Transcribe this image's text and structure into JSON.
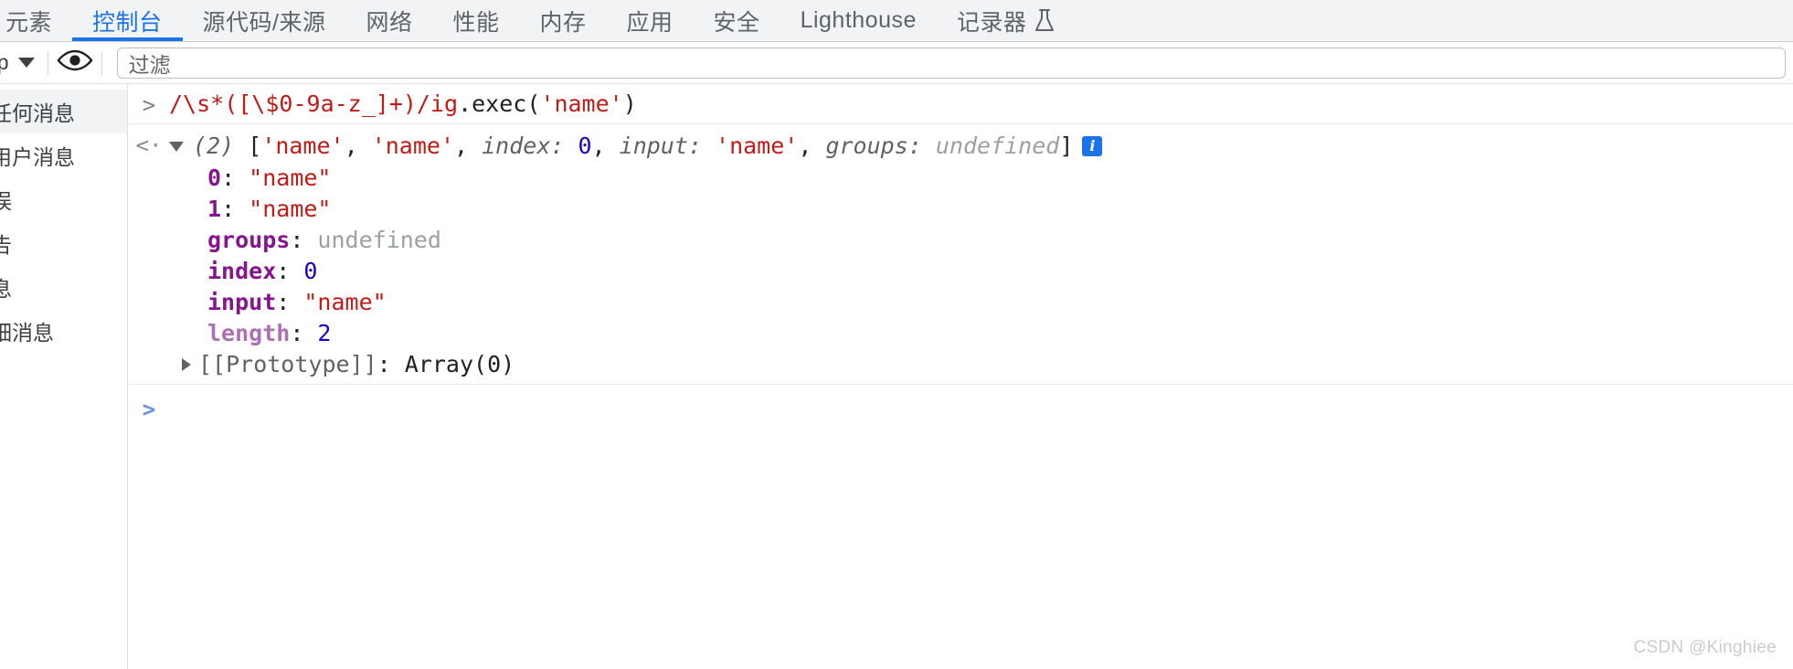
{
  "tabs": [
    {
      "label": "元素",
      "active": false,
      "icon": null
    },
    {
      "label": "控制台",
      "active": true,
      "icon": null
    },
    {
      "label": "源代码/来源",
      "active": false,
      "icon": null
    },
    {
      "label": "网络",
      "active": false,
      "icon": null
    },
    {
      "label": "性能",
      "active": false,
      "icon": null
    },
    {
      "label": "内存",
      "active": false,
      "icon": null
    },
    {
      "label": "应用",
      "active": false,
      "icon": null
    },
    {
      "label": "安全",
      "active": false,
      "icon": null
    },
    {
      "label": "Lighthouse",
      "active": false,
      "icon": null
    },
    {
      "label": "记录器",
      "active": false,
      "icon": "flask-icon"
    }
  ],
  "toolbar": {
    "context_value": "op",
    "context_icon": "chevron-down-icon",
    "eye_icon": "eye-icon",
    "filter_placeholder": "过滤"
  },
  "sidebar": {
    "items": [
      {
        "label": "任何消息",
        "selected": true
      },
      {
        "label": "用户消息",
        "selected": false
      },
      {
        "label": "误",
        "selected": false
      },
      {
        "label": "告",
        "selected": false
      },
      {
        "label": "息",
        "selected": false
      },
      {
        "label": "细消息",
        "selected": false
      }
    ]
  },
  "console": {
    "input_prompt": ">",
    "input_regex": "/\\s*([\\$0-9a-z_]+)/ig",
    "input_call": ".exec(",
    "input_arg": "'name'",
    "input_close": ")",
    "return_prompt": "<·",
    "result": {
      "count": "(2)",
      "open_bracket": "[",
      "item0": "'name'",
      "comma1": ", ",
      "item1": "'name'",
      "comma2": ", ",
      "meta_index_key": "index: ",
      "meta_index_val": "0",
      "comma3": ", ",
      "meta_input_key": "input: ",
      "meta_input_val": "'name'",
      "comma4": ", ",
      "meta_groups_key": "groups: ",
      "meta_groups_val": "undefined",
      "close_bracket": "]",
      "info_icon_label": "i"
    },
    "properties": [
      {
        "key": "0",
        "sep": ": ",
        "value": "\"name\"",
        "kind": "str",
        "keykind": "key"
      },
      {
        "key": "1",
        "sep": ": ",
        "value": "\"name\"",
        "kind": "str",
        "keykind": "key"
      },
      {
        "key": "groups",
        "sep": ": ",
        "value": "undefined",
        "kind": "undef",
        "keykind": "key"
      },
      {
        "key": "index",
        "sep": ": ",
        "value": "0",
        "kind": "num",
        "keykind": "key"
      },
      {
        "key": "input",
        "sep": ": ",
        "value": "\"name\"",
        "kind": "str",
        "keykind": "key"
      },
      {
        "key": "length",
        "sep": ": ",
        "value": "2",
        "kind": "num",
        "keykind": "keydim"
      }
    ],
    "prototype_row": {
      "label": "[[Prototype]]",
      "sep": ": ",
      "value": "Array(0)"
    },
    "new_prompt": ">"
  },
  "watermark": "CSDN @Kinghiee",
  "colors": {
    "accent": "#1a73e8",
    "string": "#c41a16",
    "number": "#1c00cf",
    "key": "#881391",
    "undefined": "#9aa0a6",
    "tabbar_bg": "#f1f3f4"
  }
}
